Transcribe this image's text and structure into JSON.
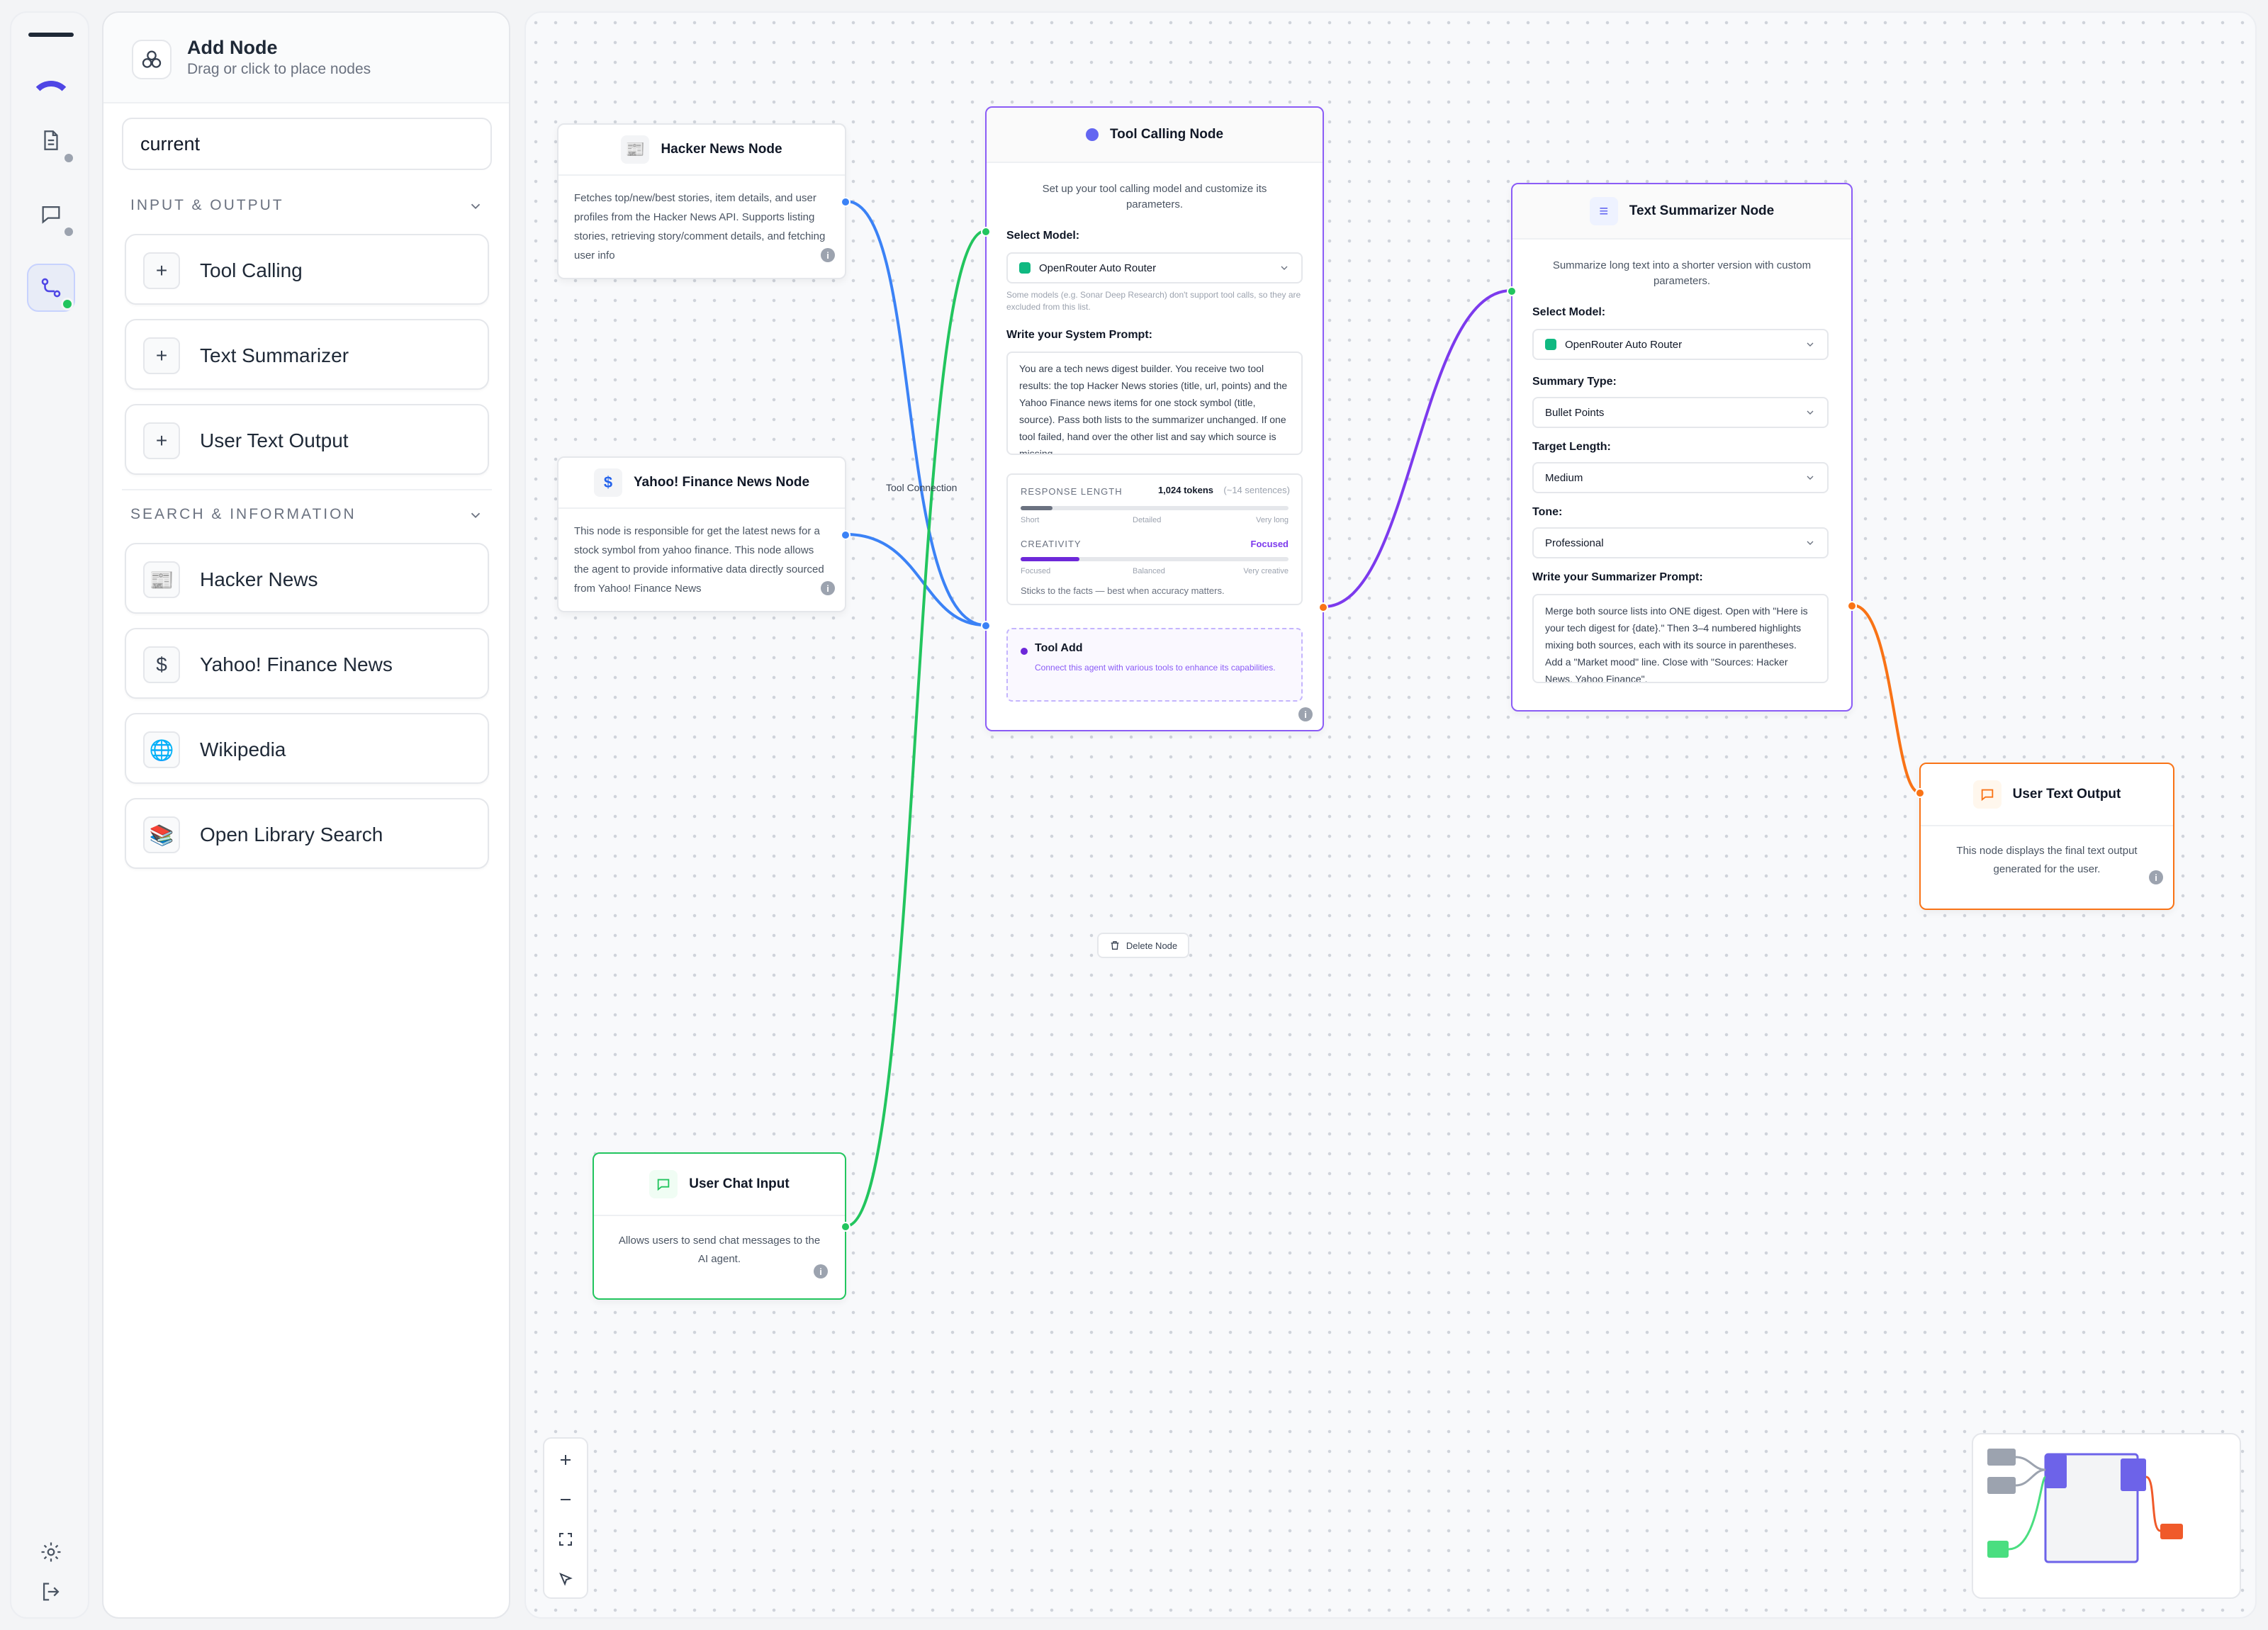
{
  "rail": {
    "icons": [
      "document-icon",
      "chat-icon",
      "flow-icon",
      "settings-icon",
      "logout-icon"
    ]
  },
  "panel": {
    "title": "Add Node",
    "subtitle": "Drag or click to place nodes",
    "search_value": "current",
    "categories": [
      {
        "label": "INPUT & OUTPUT",
        "items": [
          {
            "label": "Tool Calling",
            "icon": "+"
          },
          {
            "label": "Text Summarizer",
            "icon": "+"
          },
          {
            "label": "User Text Output",
            "icon": "+"
          }
        ]
      },
      {
        "label": "SEARCH & INFORMATION",
        "items": [
          {
            "label": "Hacker News",
            "icon": "📰"
          },
          {
            "label": "Yahoo! Finance News",
            "icon": "$"
          },
          {
            "label": "Wikipedia",
            "icon": "🌐"
          },
          {
            "label": "Open Library Search",
            "icon": "📚"
          }
        ]
      }
    ]
  },
  "nodes": {
    "hacker_news": {
      "title": "Hacker News Node",
      "icon": "📰",
      "desc": "Fetches top/new/best stories, item details, and user profiles from the Hacker News API. Supports listing stories, retrieving story/comment details, and fetching user info"
    },
    "yahoo": {
      "title": "Yahoo! Finance News Node",
      "icon": "$",
      "desc": "This node is responsible for get the latest news for a stock symbol from yahoo finance. This node allows the agent to provide informative data directly sourced from Yahoo! Finance News"
    },
    "tool_connection_label": "Tool Connection",
    "tool_calling": {
      "title": "Tool Calling Node",
      "desc": "Set up your tool calling model and customize its parameters.",
      "select_model_label": "Select Model:",
      "model": "OpenRouter Auto Router",
      "model_note": "Some models (e.g. Sonar Deep Research) don't support tool calls, so they are excluded from this list.",
      "prompt_label": "Write your System Prompt:",
      "prompt": "You are a tech news digest builder. You receive two tool results: the top Hacker News stories (title, url, points) and the Yahoo Finance news items for one stock symbol (title, source). Pass both lists to the summarizer unchanged. If one tool failed, hand over the other list and say which source is missing.",
      "response_length_label": "RESPONSE LENGTH",
      "response_length_value": "1,024 tokens",
      "response_length_hint": "(~14 sentences)",
      "response_length_fraction": 0.12,
      "rl_ticks": [
        "Short",
        "Detailed",
        "Very long"
      ],
      "creativity_label": "CREATIVITY",
      "creativity_value": "Focused",
      "creativity_fraction": 0.22,
      "cr_ticks": [
        "Focused",
        "Balanced",
        "Very creative"
      ],
      "creativity_note": "Sticks to the facts — best when accuracy matters.",
      "tool_add_title": "Tool Add",
      "tool_add_desc": "Connect this agent with various tools to enhance its capabilities."
    },
    "delete_label": "Delete Node",
    "summarizer": {
      "title": "Text Summarizer Node",
      "icon": "≡",
      "desc": "Summarize long text into a shorter version with custom parameters.",
      "select_model_label": "Select Model:",
      "model": "OpenRouter Auto Router",
      "summary_type_label": "Summary Type:",
      "summary_type": "Bullet Points",
      "target_length_label": "Target Length:",
      "target_length": "Medium",
      "tone_label": "Tone:",
      "tone": "Professional",
      "prompt_label": "Write your Summarizer Prompt:",
      "prompt": "Merge both source lists into ONE digest. Open with \"Here is your tech digest for {date}.\" Then 3–4 numbered highlights mixing both sources, each with its source in parentheses. Add a \"Market mood\" line. Close with \"Sources: Hacker News, Yahoo Finance\"."
    },
    "user_output": {
      "title": "User Text Output",
      "desc": "This node displays the final text output generated for the user."
    },
    "user_input": {
      "title": "User Chat Input",
      "desc": "Allows users to send chat messages to the AI agent."
    }
  },
  "colors": {
    "accent": "#7c3aed",
    "blue": "#3b82f6",
    "green": "#22c55e",
    "orange": "#f97316"
  },
  "controls": [
    "zoom-in-icon",
    "zoom-out-icon",
    "fit-view-icon",
    "lock-icon"
  ]
}
